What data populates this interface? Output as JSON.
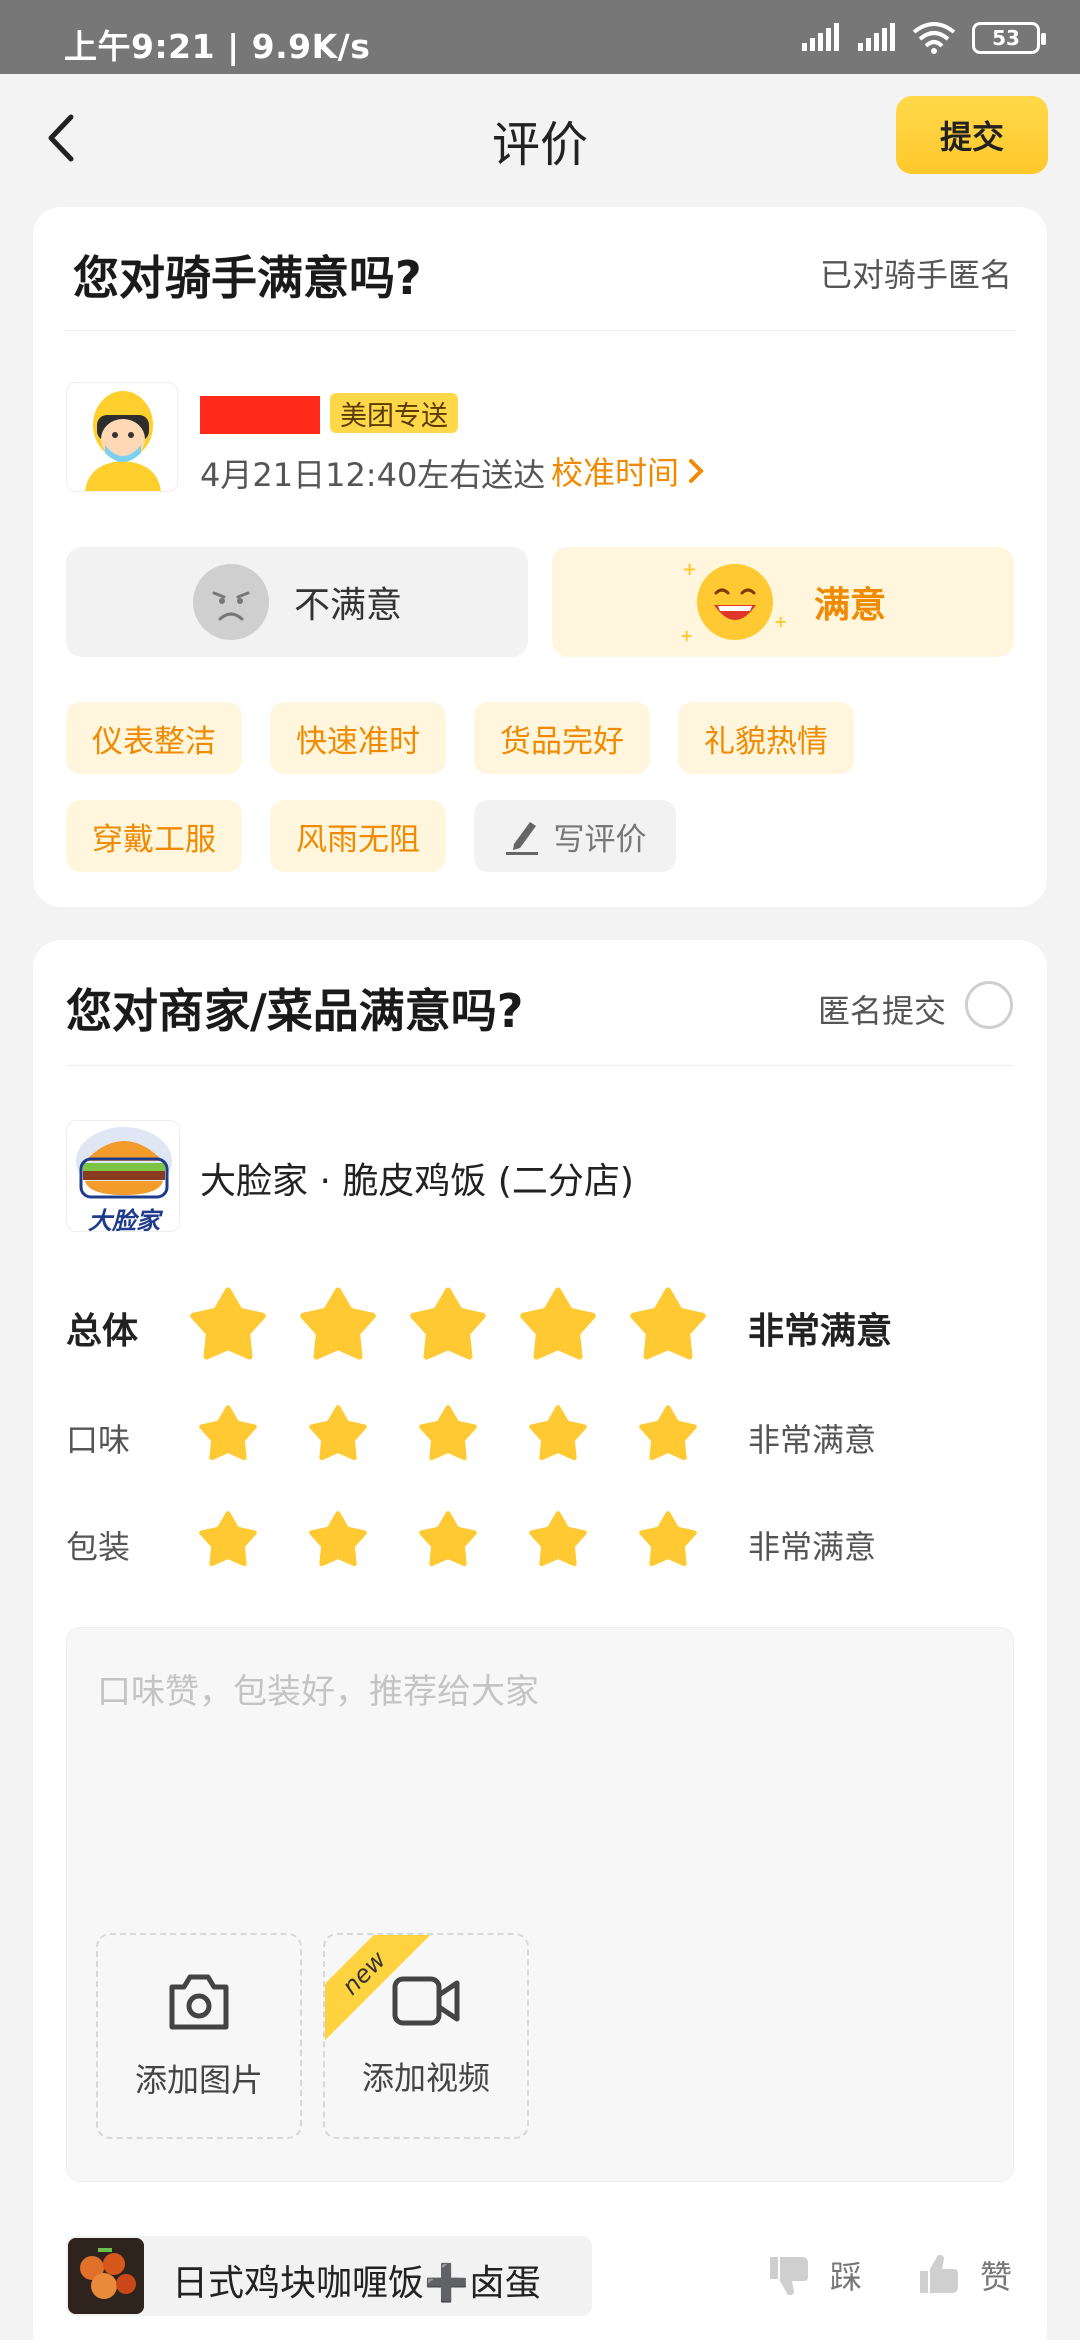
{
  "status_bar": {
    "time": "上午9:21 | 9.9K/s",
    "battery": "53"
  },
  "nav": {
    "title": "评价",
    "submit": "提交"
  },
  "rider": {
    "question": "您对骑手满意吗?",
    "anonymous": "已对骑手匿名",
    "badge": "美团专送",
    "delivery_time": "4月21日12:40左右送达",
    "calibrate": "校准时间",
    "unsatisfied": "不满意",
    "satisfied": "满意",
    "tags": [
      "仪表整洁",
      "快速准时",
      "货品完好",
      "礼貌热情",
      "穿戴工服",
      "风雨无阻"
    ],
    "write_review": "写评价"
  },
  "merchant": {
    "question": "您对商家/菜品满意吗?",
    "anonymous_submit": "匿名提交",
    "logo_text": "大脸家",
    "name": "大脸家 · 脆皮鸡饭 (二分店)",
    "ratings": [
      {
        "label": "总体",
        "stars": 5,
        "text": "非常满意"
      },
      {
        "label": "口味",
        "stars": 5,
        "text": "非常满意"
      },
      {
        "label": "包装",
        "stars": 5,
        "text": "非常满意"
      }
    ],
    "review_placeholder": "口味赞，包装好，推荐给大家",
    "add_photo": "添加图片",
    "add_video": "添加视频",
    "new_badge": "new"
  },
  "dish": {
    "name": "日式鸡块咖喱饭➕卤蛋",
    "dislike": "踩",
    "like": "赞"
  },
  "colors": {
    "accent": "#f08a00",
    "star": "#ffc933",
    "submit_bg": "#ffd23f"
  }
}
